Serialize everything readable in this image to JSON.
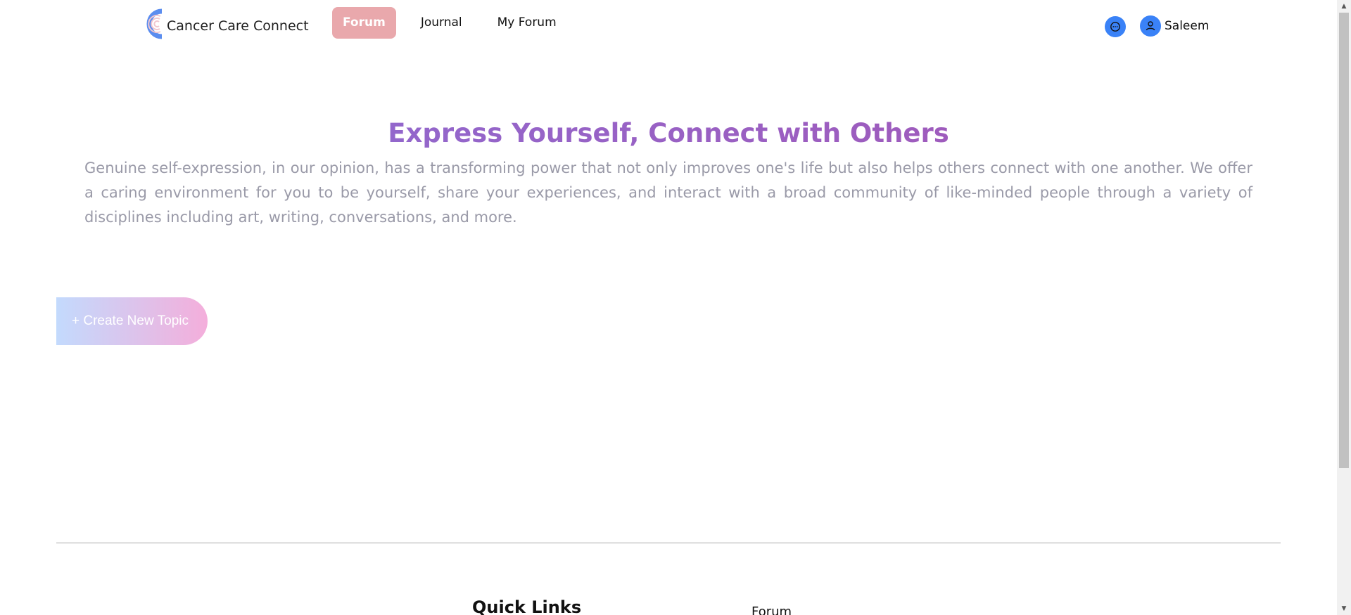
{
  "brand": {
    "name": "Cancer Care Connect"
  },
  "nav": {
    "items": [
      {
        "label": "Forum",
        "active": true
      },
      {
        "label": "Journal",
        "active": false
      },
      {
        "label": "My Forum",
        "active": false
      }
    ]
  },
  "user": {
    "name": "Saleem"
  },
  "icons": {
    "chat": "chat-bubble-icon",
    "user": "user-icon",
    "logo": "logo-c-icon"
  },
  "hero": {
    "title": "Express Yourself, Connect with Others",
    "description": "Genuine self-expression, in our opinion, has a transforming power that not only improves one's life but also helps others connect with one another. We offer a caring environment for you to be yourself, share your experiences, and interact with a broad community of like-minded people through a variety of disciplines including art, writing, conversations, and more."
  },
  "actions": {
    "create_topic": "+ Create New Topic"
  },
  "footer": {
    "quick_links_heading": "Quick Links",
    "links": [
      "Forum"
    ]
  },
  "colors": {
    "accent_blue": "#3a82f7",
    "active_nav": "#e9a8ac",
    "title_gradient_start": "#8b6fd6",
    "title_gradient_end": "#a653b2"
  }
}
